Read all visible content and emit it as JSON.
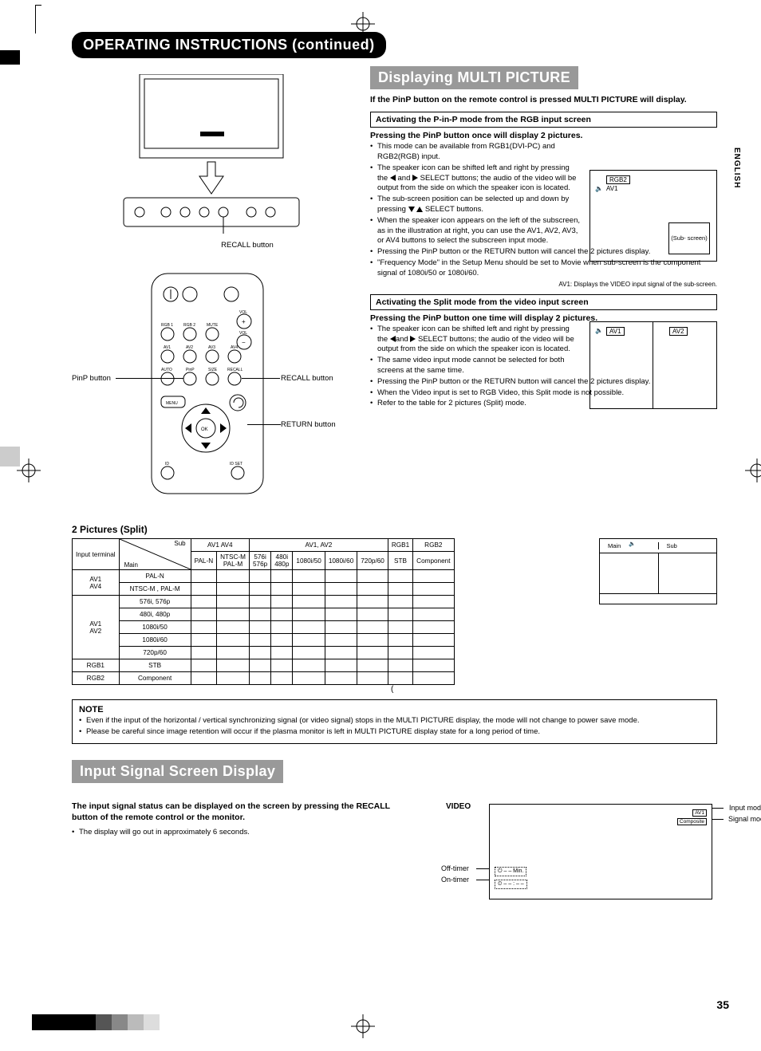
{
  "page": {
    "number": "35",
    "lang_tab": "ENGLISH"
  },
  "h1": "OPERATING INSTRUCTIONS (continued)",
  "monitor": {
    "recall_label": "RECALL button"
  },
  "remote": {
    "pinp_label": "PinP button",
    "recall_label": "RECALL button",
    "return_label": "RETURN button",
    "btn_rgb1": "RGB 1",
    "btn_rgb2": "RGB 2",
    "btn_mute": "MUTE",
    "btn_av1": "AV1",
    "btn_av2": "AV2",
    "btn_av3": "AV3",
    "btn_av4": "AV4",
    "btn_auto": "AUTO",
    "btn_pinp": "PinP",
    "btn_size": "SIZE",
    "btn_recall": "RECALL",
    "btn_menu": "MENU",
    "btn_ok": "OK",
    "btn_id": "ID",
    "btn_idset": "ID SET",
    "btn_vol": "VOL"
  },
  "multi": {
    "h2": "Displaying MULTI PICTURE",
    "intro": "If the PinP button on the remote control is pressed MULTI PICTURE will display.",
    "box1": "Activating the P-in-P mode from the RGB input screen",
    "sub1": "Pressing the PinP button once will display 2 pictures.",
    "b1_1": "This mode can be available from RGB1(DVI-PC) and RGB2(RGB) input.",
    "b1_2a": "The speaker icon can be shifted left and right by pressing the ",
    "b1_2b": " and ",
    "b1_2c": " SELECT buttons; the audio of the video will be output from the side on which the speaker icon is located.",
    "b1_3a": "The sub-screen position can be selected up and down by pressing ",
    "b1_3b": " SELECT buttons.",
    "b1_4": "When the speaker icon appears on the left of the subscreen, as in the illustration at right, you can use the AV1, AV2, AV3, or AV4 buttons to select the subscreen input mode.",
    "b1_5": "Pressing the PinP button or the RETURN button will cancel the 2 pictures display.",
    "b1_6": "\"Frequency Mode\" in the Setup Menu should be set to Movie when sub-screen is the component signal of 1080i/50 or 1080i/60.",
    "pip1_top": "RGB2",
    "pip1_av": "AV1",
    "pip1_sub": "(Sub-\nscreen)",
    "pip1_note": "AV1: Displays the VIDEO input signal of the sub-screen.",
    "box2": "Activating the Split mode from the video input screen",
    "sub2": "Pressing the PinP button one time will display 2 pictures.",
    "b2_1a": "The speaker icon can be shifted left and right by pressing the",
    "b2_1b": "and",
    "b2_1c": "SELECT buttons; the audio of the video will be output from the side on which the speaker icon is located.",
    "b2_2": "The same video input mode cannot be selected for both screens at the same time.",
    "b2_3": "Pressing the PinP button or the RETURN button will cancel the 2 pictures display.",
    "b2_4": "When the Video input is set to RGB Video, this Split mode is not possible.",
    "b2_5": "Refer to the table for 2 pictures (Split) mode.",
    "pip2_l": "AV1",
    "pip2_r": "AV2"
  },
  "table": {
    "title": "2 Pictures (Split)",
    "hdr_input": "Input terminal",
    "hdr_main": "Main",
    "hdr_sub": "Sub",
    "cg_av14": "AV1   AV4",
    "cg_av12": "AV1, AV2",
    "cg_rgb1": "RGB1",
    "cg_rgb2": "RGB2",
    "c_paln": "PAL-N",
    "c_ntscm": "NTSC-M\nPAL-M",
    "c_576": "576i\n576p",
    "c_480": "480i\n480p",
    "c_108050": "1080i/50",
    "c_108060": "1080i/60",
    "c_72060": "720p/60",
    "c_stb": "STB",
    "c_comp": "Component",
    "r1_hdr": "AV1\nAV4",
    "r1a": "PAL-N",
    "r1b": "NTSC-M , PAL-M",
    "r2_hdr": "AV1\nAV2",
    "r2a": "576i, 576p",
    "r2b": "480i, 480p",
    "r2c": "1080i/50",
    "r2d": "1080i/60",
    "r2e": "720p/60",
    "r3_hdr": "RGB1",
    "r3a": "STB",
    "r4_hdr": "RGB2",
    "r4a": "Component",
    "foot_paren": "(",
    "mini_main": "Main",
    "mini_sub": "Sub"
  },
  "note": {
    "title": "NOTE",
    "n1": "Even if the input of the horizontal / vertical synchronizing signal (or video signal) stops in the MULTI PICTURE display, the mode will not change to power save mode.",
    "n2": "Please be careful since image retention will occur if the plasma monitor is left in MULTI PICTURE display state for a long period of time."
  },
  "input": {
    "h2": "Input Signal Screen Display",
    "intro": "The input signal status can be displayed on the screen by pressing the RECALL button of the remote control or the monitor.",
    "b1": "The display will go out in approximately 6 seconds.",
    "vhdr": "VIDEO",
    "mode_in": "Input mode",
    "mode_sig": "Signal mode",
    "off": "Off-timer",
    "on": "On-timer",
    "box_av1": "AV1",
    "box_comp": "Composite",
    "min": "– – Min.",
    "clk": "– – : – –"
  }
}
